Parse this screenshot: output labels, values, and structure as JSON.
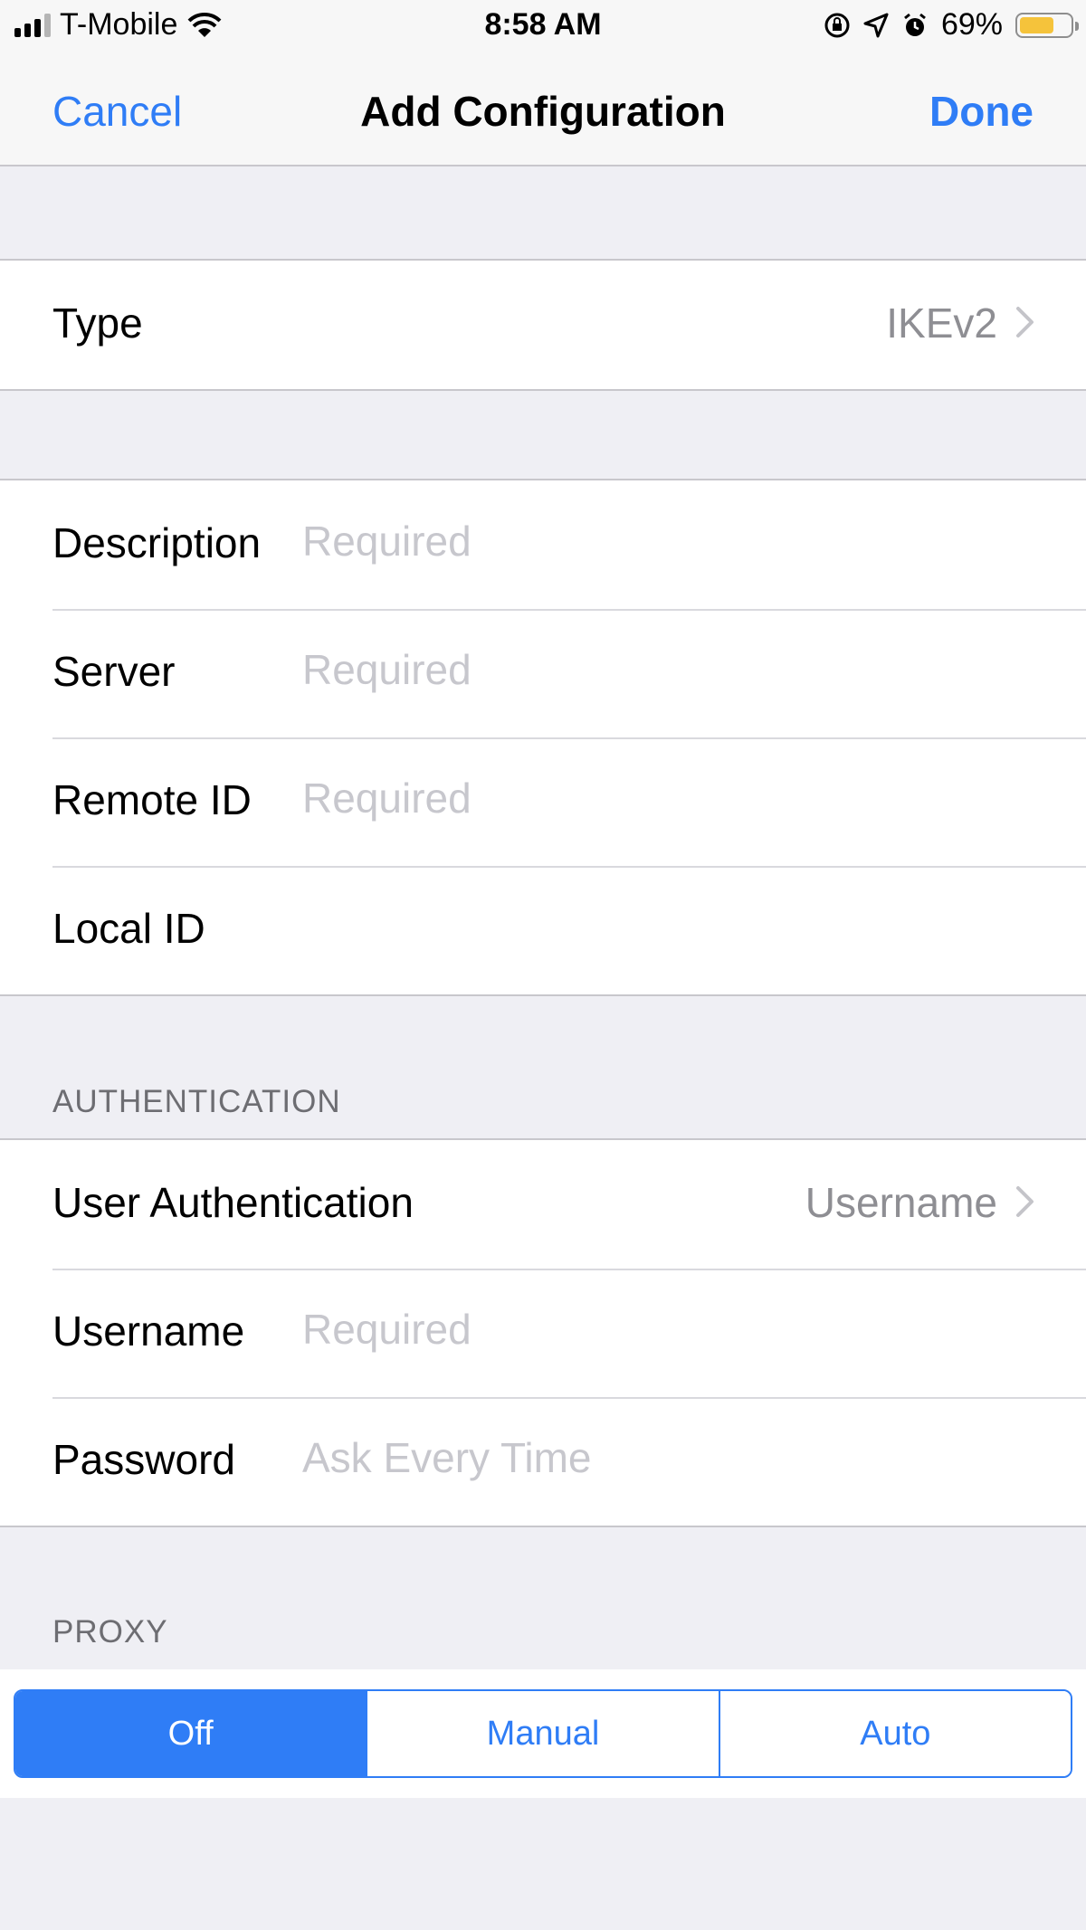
{
  "status_bar": {
    "carrier": "T-Mobile",
    "time": "8:58 AM",
    "battery_percent": "69%",
    "battery_level": 0.69,
    "icons": [
      "signal-icon",
      "wifi-icon",
      "orientation-lock-icon",
      "location-icon",
      "alarm-icon",
      "battery-icon"
    ]
  },
  "nav": {
    "cancel": "Cancel",
    "title": "Add Configuration",
    "done": "Done"
  },
  "type_group": {
    "label": "Type",
    "value": "IKEv2"
  },
  "config_group": {
    "description": {
      "label": "Description",
      "placeholder": "Required"
    },
    "server": {
      "label": "Server",
      "placeholder": "Required"
    },
    "remote_id": {
      "label": "Remote ID",
      "placeholder": "Required"
    },
    "local_id": {
      "label": "Local ID",
      "placeholder": ""
    }
  },
  "authentication": {
    "header": "AUTHENTICATION",
    "user_auth": {
      "label": "User Authentication",
      "value": "Username"
    },
    "username": {
      "label": "Username",
      "placeholder": "Required"
    },
    "password": {
      "label": "Password",
      "placeholder": "Ask Every Time"
    }
  },
  "proxy": {
    "header": "PROXY",
    "options": [
      "Off",
      "Manual",
      "Auto"
    ],
    "selected": "Off"
  },
  "colors": {
    "accent": "#2f7df6",
    "background": "#efeff4",
    "placeholder": "#c7c7cd",
    "battery": "#f5c33b"
  }
}
